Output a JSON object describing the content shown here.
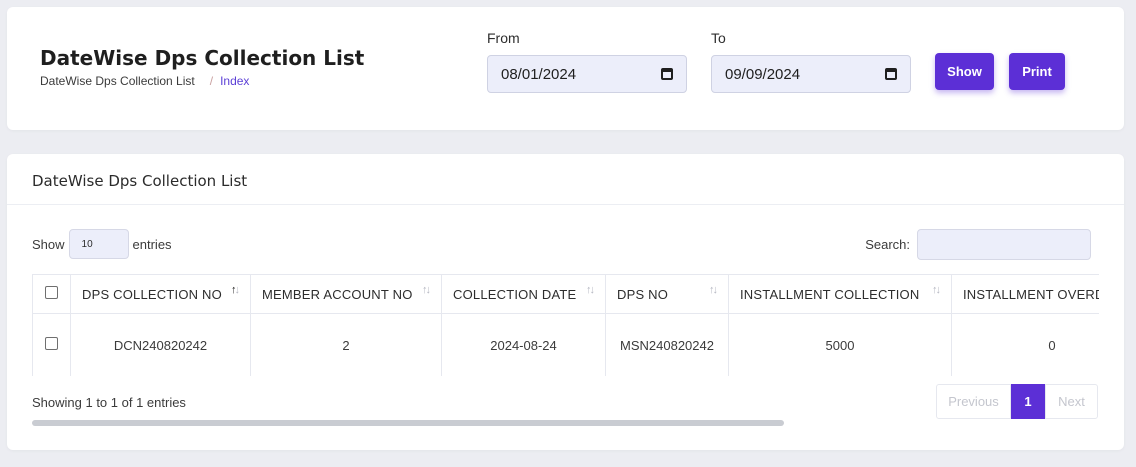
{
  "header": {
    "title": "DateWise Dps Collection List",
    "breadcrumb": {
      "current": "DateWise Dps Collection List",
      "separator": "/",
      "link": "Index"
    },
    "from": {
      "label": "From",
      "value": "08/01/2024"
    },
    "to": {
      "label": "To",
      "value": "09/09/2024"
    },
    "show_label": "Show",
    "print_label": "Print"
  },
  "list": {
    "title": "DateWise Dps Collection List",
    "show_prefix": "Show",
    "page_length": "10",
    "show_suffix": "entries",
    "search_label": "Search:",
    "columns": [
      "DPS COLLECTION NO",
      "MEMBER ACCOUNT NO",
      "COLLECTION DATE",
      "DPS NO",
      "INSTALLMENT COLLECTION",
      "INSTALLMENT OVERDUE"
    ],
    "rows": [
      [
        "DCN240820242",
        "2",
        "2024-08-24",
        "MSN240820242",
        "5000",
        "0"
      ]
    ],
    "info": "Showing 1 to 1 of 1 entries",
    "pager": {
      "previous": "Previous",
      "current": "1",
      "next": "Next"
    }
  },
  "colors": {
    "accent": "#5c2fd6",
    "background": "#ecedf2",
    "input_bg": "#eceefa"
  },
  "icons": {
    "date": "calendar-icon",
    "sort": "sort-arrows-icon"
  }
}
